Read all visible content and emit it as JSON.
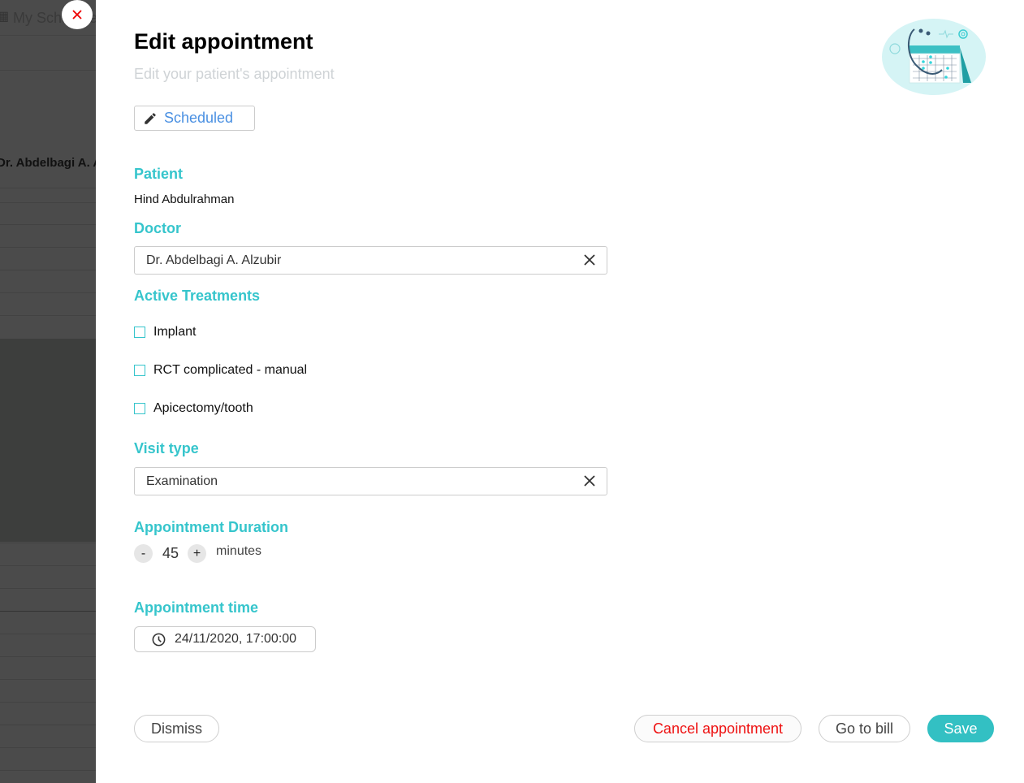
{
  "backdrop": {
    "page_title": "My Schedule",
    "doctor_column": "Dr. Abdelbagi A. Alzubir"
  },
  "drawer": {
    "title": "Edit appointment",
    "subtitle": "Edit your patient's appointment",
    "status_button": {
      "label": "Scheduled",
      "icon": "pencil-icon"
    },
    "patient": {
      "label": "Patient",
      "value": "Hind Abdulrahman"
    },
    "doctor": {
      "label": "Doctor",
      "value": "Dr. Abdelbagi A. Alzubir"
    },
    "active_treatments": {
      "label": "Active Treatments",
      "items": [
        {
          "label": "Implant",
          "checked": false
        },
        {
          "label": "RCT complicated - manual",
          "checked": false
        },
        {
          "label": "Apicectomy/tooth",
          "checked": false
        }
      ]
    },
    "visit_type": {
      "label": "Visit type",
      "value": "Examination"
    },
    "duration": {
      "label": "Appointment Duration",
      "decrement": "-",
      "value": "45",
      "increment": "+",
      "unit": "minutes"
    },
    "appointment_time": {
      "label": "Appointment time",
      "value": "24/11/2020, 17:00:00",
      "icon": "clock-icon"
    },
    "actions": {
      "dismiss": "Dismiss",
      "cancel_appointment": "Cancel appointment",
      "go_to_bill": "Go to bill",
      "save": "Save"
    }
  },
  "colors": {
    "accent": "#36c5cc",
    "save_button": "#33c0c3",
    "status_text": "#4a90e2",
    "danger": "#ee1111"
  }
}
